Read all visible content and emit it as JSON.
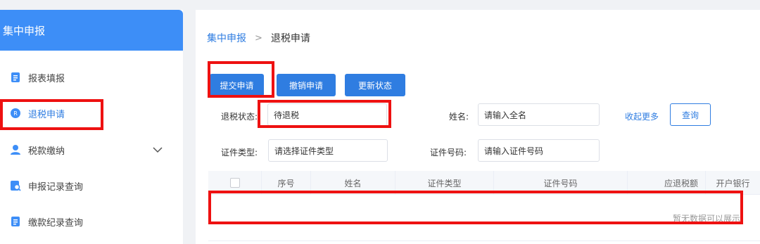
{
  "sidebar": {
    "title": "集中申报",
    "items": [
      {
        "label": "报表填报",
        "icon": "form-icon"
      },
      {
        "label": "退税申请",
        "icon": "refund-icon",
        "active": true
      },
      {
        "label": "税款缴纳",
        "icon": "user-tax-icon",
        "expandable": true
      },
      {
        "label": "申报记录查询",
        "icon": "record-search-icon"
      },
      {
        "label": "缴款纪录查询",
        "icon": "payment-record-icon"
      }
    ]
  },
  "breadcrumb": {
    "parent": "集中申报",
    "separator": ">",
    "current": "退税申请"
  },
  "toolbar": {
    "submit_label": "提交申请",
    "cancel_label": "撤销申请",
    "refresh_label": "更新状态"
  },
  "filters": {
    "status_label": "退税状态:",
    "status_value": "待退税",
    "name_label": "姓名:",
    "name_placeholder": "请输入全名",
    "collapse_label": "收起更多",
    "query_label": "查询",
    "id_type_label": "证件类型:",
    "id_type_placeholder": "请选择证件类型",
    "id_number_label": "证件号码:",
    "id_number_placeholder": "请输入证件号码"
  },
  "table": {
    "columns": [
      "序号",
      "姓名",
      "证件类型",
      "证件号码",
      "应退税额",
      "开户银行"
    ],
    "empty_text": "暂无数据可以展示"
  },
  "colors": {
    "primary": "#2f7de1",
    "sidebar_header": "#3d8ef7",
    "annotation": "#ee1111"
  }
}
